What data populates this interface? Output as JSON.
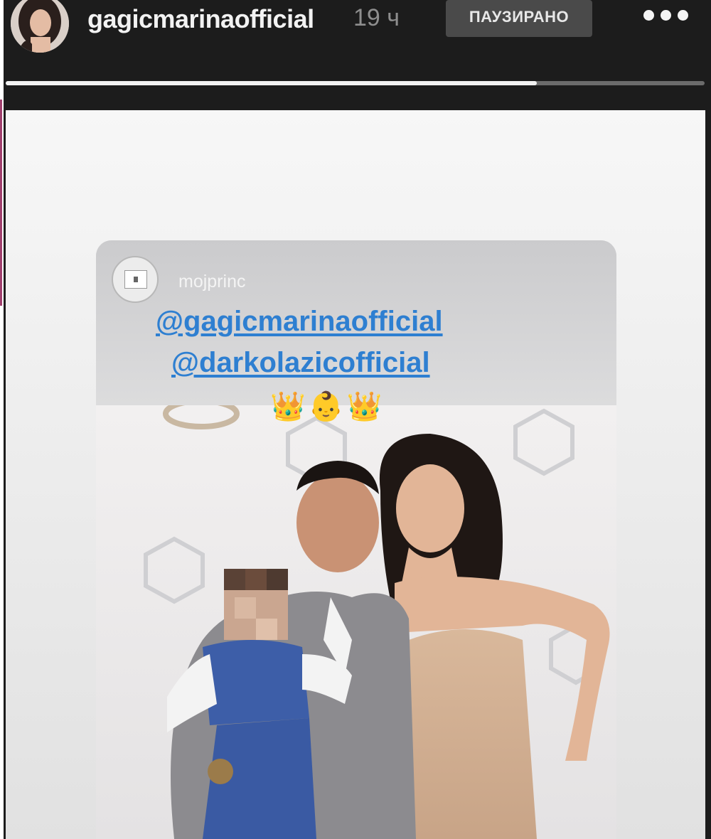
{
  "header": {
    "username": "gagicmarinaofficial",
    "time": "19 ч",
    "paused_label": "ПАУЗИРАНО",
    "more_icon": "more-horizontal-icon",
    "progress_fraction": 0.76
  },
  "shared_post": {
    "username": "mojprinc",
    "mentions": [
      "@gagicmarinaofficial",
      "@darkolazicofficial"
    ],
    "emojis": "👑👶👑"
  },
  "colors": {
    "background": "#1c1c1c",
    "mention": "#2e7fd1",
    "paused_badge": "#4a4a4a"
  }
}
